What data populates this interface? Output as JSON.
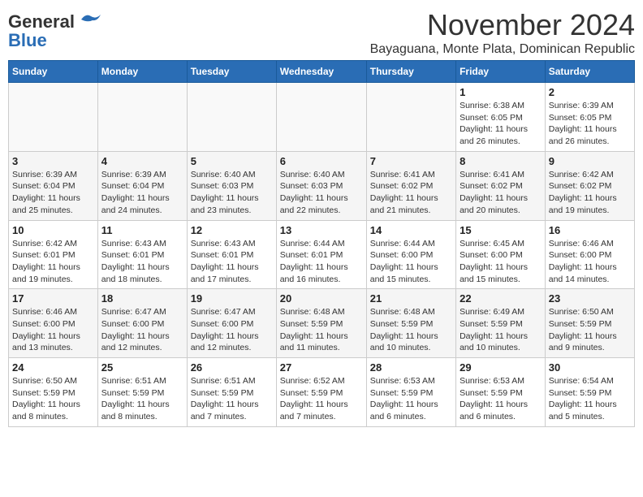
{
  "header": {
    "logo_general": "General",
    "logo_blue": "Blue",
    "month": "November 2024",
    "location": "Bayaguana, Monte Plata, Dominican Republic"
  },
  "weekdays": [
    "Sunday",
    "Monday",
    "Tuesday",
    "Wednesday",
    "Thursday",
    "Friday",
    "Saturday"
  ],
  "weeks": [
    [
      {
        "day": "",
        "info": ""
      },
      {
        "day": "",
        "info": ""
      },
      {
        "day": "",
        "info": ""
      },
      {
        "day": "",
        "info": ""
      },
      {
        "day": "",
        "info": ""
      },
      {
        "day": "1",
        "info": "Sunrise: 6:38 AM\nSunset: 6:05 PM\nDaylight: 11 hours\nand 26 minutes."
      },
      {
        "day": "2",
        "info": "Sunrise: 6:39 AM\nSunset: 6:05 PM\nDaylight: 11 hours\nand 26 minutes."
      }
    ],
    [
      {
        "day": "3",
        "info": "Sunrise: 6:39 AM\nSunset: 6:04 PM\nDaylight: 11 hours\nand 25 minutes."
      },
      {
        "day": "4",
        "info": "Sunrise: 6:39 AM\nSunset: 6:04 PM\nDaylight: 11 hours\nand 24 minutes."
      },
      {
        "day": "5",
        "info": "Sunrise: 6:40 AM\nSunset: 6:03 PM\nDaylight: 11 hours\nand 23 minutes."
      },
      {
        "day": "6",
        "info": "Sunrise: 6:40 AM\nSunset: 6:03 PM\nDaylight: 11 hours\nand 22 minutes."
      },
      {
        "day": "7",
        "info": "Sunrise: 6:41 AM\nSunset: 6:02 PM\nDaylight: 11 hours\nand 21 minutes."
      },
      {
        "day": "8",
        "info": "Sunrise: 6:41 AM\nSunset: 6:02 PM\nDaylight: 11 hours\nand 20 minutes."
      },
      {
        "day": "9",
        "info": "Sunrise: 6:42 AM\nSunset: 6:02 PM\nDaylight: 11 hours\nand 19 minutes."
      }
    ],
    [
      {
        "day": "10",
        "info": "Sunrise: 6:42 AM\nSunset: 6:01 PM\nDaylight: 11 hours\nand 19 minutes."
      },
      {
        "day": "11",
        "info": "Sunrise: 6:43 AM\nSunset: 6:01 PM\nDaylight: 11 hours\nand 18 minutes."
      },
      {
        "day": "12",
        "info": "Sunrise: 6:43 AM\nSunset: 6:01 PM\nDaylight: 11 hours\nand 17 minutes."
      },
      {
        "day": "13",
        "info": "Sunrise: 6:44 AM\nSunset: 6:01 PM\nDaylight: 11 hours\nand 16 minutes."
      },
      {
        "day": "14",
        "info": "Sunrise: 6:44 AM\nSunset: 6:00 PM\nDaylight: 11 hours\nand 15 minutes."
      },
      {
        "day": "15",
        "info": "Sunrise: 6:45 AM\nSunset: 6:00 PM\nDaylight: 11 hours\nand 15 minutes."
      },
      {
        "day": "16",
        "info": "Sunrise: 6:46 AM\nSunset: 6:00 PM\nDaylight: 11 hours\nand 14 minutes."
      }
    ],
    [
      {
        "day": "17",
        "info": "Sunrise: 6:46 AM\nSunset: 6:00 PM\nDaylight: 11 hours\nand 13 minutes."
      },
      {
        "day": "18",
        "info": "Sunrise: 6:47 AM\nSunset: 6:00 PM\nDaylight: 11 hours\nand 12 minutes."
      },
      {
        "day": "19",
        "info": "Sunrise: 6:47 AM\nSunset: 6:00 PM\nDaylight: 11 hours\nand 12 minutes."
      },
      {
        "day": "20",
        "info": "Sunrise: 6:48 AM\nSunset: 5:59 PM\nDaylight: 11 hours\nand 11 minutes."
      },
      {
        "day": "21",
        "info": "Sunrise: 6:48 AM\nSunset: 5:59 PM\nDaylight: 11 hours\nand 10 minutes."
      },
      {
        "day": "22",
        "info": "Sunrise: 6:49 AM\nSunset: 5:59 PM\nDaylight: 11 hours\nand 10 minutes."
      },
      {
        "day": "23",
        "info": "Sunrise: 6:50 AM\nSunset: 5:59 PM\nDaylight: 11 hours\nand 9 minutes."
      }
    ],
    [
      {
        "day": "24",
        "info": "Sunrise: 6:50 AM\nSunset: 5:59 PM\nDaylight: 11 hours\nand 8 minutes."
      },
      {
        "day": "25",
        "info": "Sunrise: 6:51 AM\nSunset: 5:59 PM\nDaylight: 11 hours\nand 8 minutes."
      },
      {
        "day": "26",
        "info": "Sunrise: 6:51 AM\nSunset: 5:59 PM\nDaylight: 11 hours\nand 7 minutes."
      },
      {
        "day": "27",
        "info": "Sunrise: 6:52 AM\nSunset: 5:59 PM\nDaylight: 11 hours\nand 7 minutes."
      },
      {
        "day": "28",
        "info": "Sunrise: 6:53 AM\nSunset: 5:59 PM\nDaylight: 11 hours\nand 6 minutes."
      },
      {
        "day": "29",
        "info": "Sunrise: 6:53 AM\nSunset: 5:59 PM\nDaylight: 11 hours\nand 6 minutes."
      },
      {
        "day": "30",
        "info": "Sunrise: 6:54 AM\nSunset: 5:59 PM\nDaylight: 11 hours\nand 5 minutes."
      }
    ]
  ]
}
